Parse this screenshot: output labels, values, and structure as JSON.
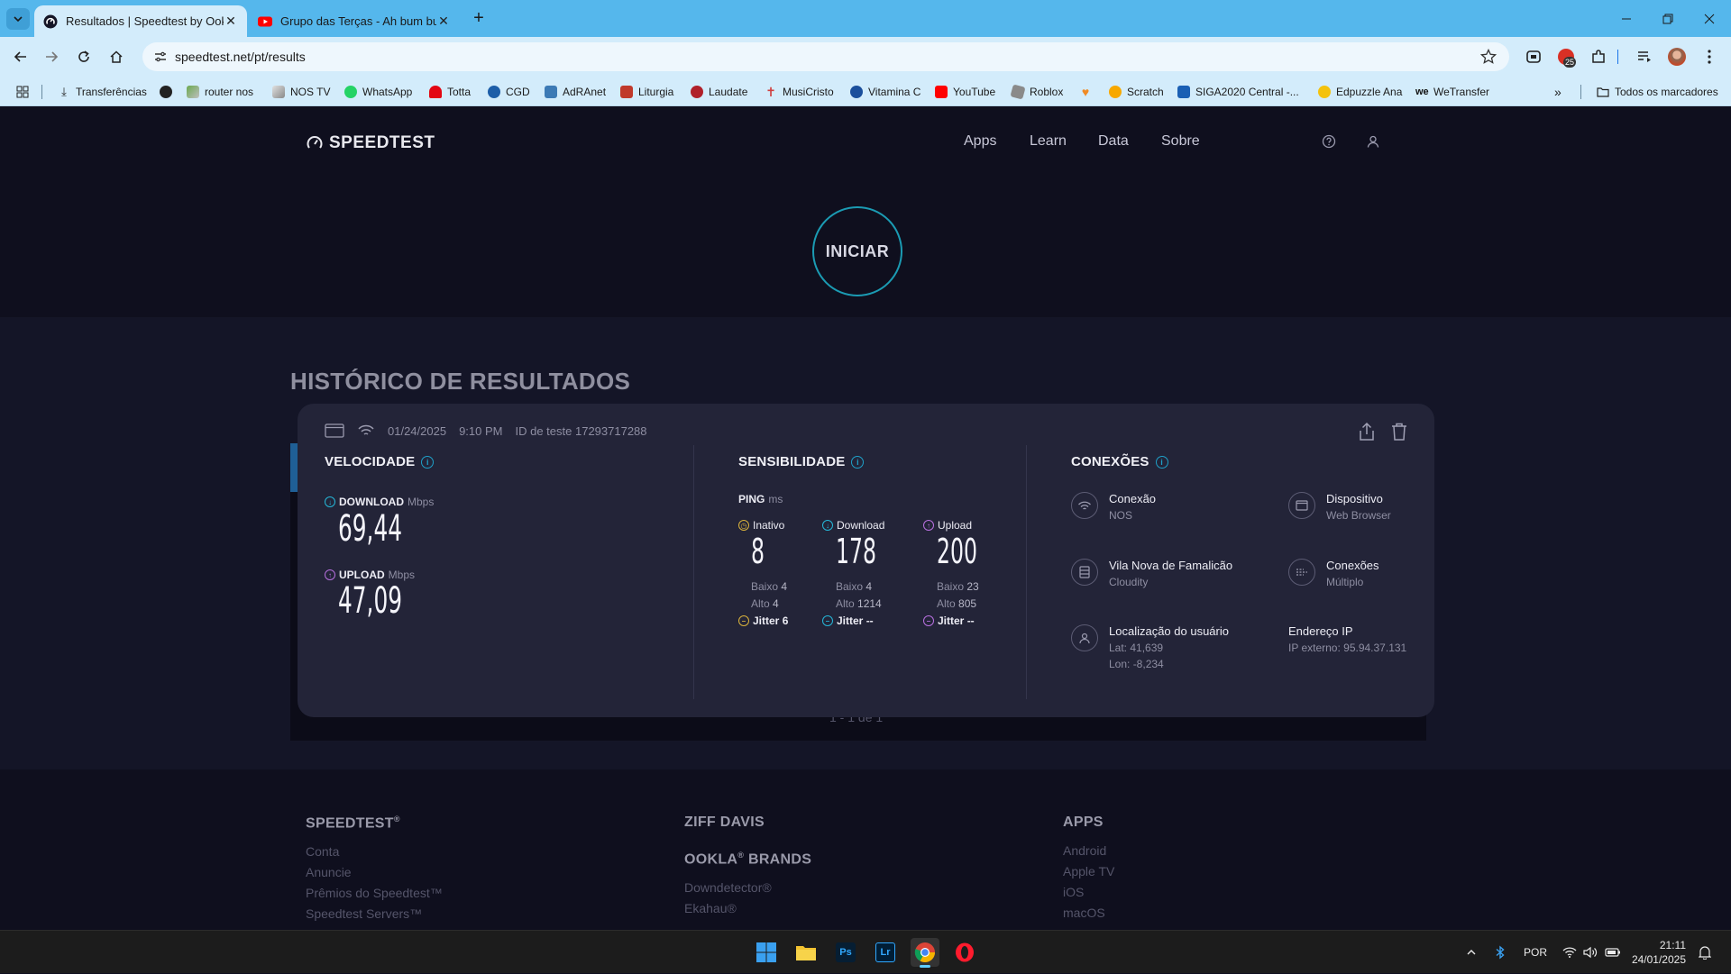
{
  "browser": {
    "tabs": [
      {
        "title": "Resultados | Speedtest by Ookla",
        "active": true
      },
      {
        "title": "Grupo das Terças - Ah bum bué",
        "active": false
      }
    ],
    "url": "speedtest.net/pt/results",
    "extension_badge": "25",
    "bookmarks": [
      {
        "label": "Transferências",
        "icon": "download-icon"
      },
      {
        "label": "",
        "icon": "globe-icon"
      },
      {
        "label": "router nos",
        "icon": "router-icon"
      },
      {
        "label": "NOS TV",
        "icon": "nos-icon"
      },
      {
        "label": "WhatsApp",
        "icon": "whatsapp-icon"
      },
      {
        "label": "Totta",
        "icon": "totta-icon"
      },
      {
        "label": "CGD",
        "icon": "cgd-icon"
      },
      {
        "label": "AdRAnet",
        "icon": "adranet-icon"
      },
      {
        "label": "Liturgia",
        "icon": "liturgia-icon"
      },
      {
        "label": "Laudate",
        "icon": "laudate-icon"
      },
      {
        "label": "MusiCristo",
        "icon": "cross-icon"
      },
      {
        "label": "Vitamina C",
        "icon": "vitamina-icon"
      },
      {
        "label": "YouTube",
        "icon": "youtube-icon"
      },
      {
        "label": "Roblox",
        "icon": "roblox-icon"
      },
      {
        "label": "",
        "icon": "heart-icon"
      },
      {
        "label": "Scratch",
        "icon": "scratch-icon"
      },
      {
        "label": "SIGA2020 Central -...",
        "icon": "siga-icon"
      },
      {
        "label": "Edpuzzle Ana",
        "icon": "edpuzzle-icon"
      },
      {
        "label": "WeTransfer",
        "icon": "wetransfer-icon"
      }
    ],
    "all_bookmarks": "Todos os marcadores"
  },
  "header": {
    "logo": "SPEEDTEST",
    "nav": [
      "Apps",
      "Learn",
      "Data",
      "Sobre"
    ]
  },
  "go_button": "INICIAR",
  "history": {
    "title": "HISTÓRICO DE RESULTADOS",
    "pager": "1 - 1 de 1",
    "card": {
      "date": "01/24/2025",
      "time": "9:10 PM",
      "test_id": "ID de teste 17293717288",
      "velocidade": {
        "title": "VELOCIDADE",
        "download_label": "DOWNLOAD",
        "download_unit": "Mbps",
        "download_value": "69,44",
        "upload_label": "UPLOAD",
        "upload_unit": "Mbps",
        "upload_value": "47,09"
      },
      "sensibilidade": {
        "title": "SENSIBILIDADE",
        "ping_label": "PING",
        "ping_unit": "ms",
        "columns": [
          {
            "label": "Inativo",
            "value": "8",
            "baixo_label": "Baixo",
            "baixo": "4",
            "alto_label": "Alto",
            "alto": "4",
            "jitter_label": "Jitter",
            "jitter": "6",
            "color": "#d9b23c"
          },
          {
            "label": "Download",
            "value": "178",
            "baixo_label": "Baixo",
            "baixo": "4",
            "alto_label": "Alto",
            "alto": "1214",
            "jitter_label": "Jitter",
            "jitter": "--",
            "color": "#25b7d8"
          },
          {
            "label": "Upload",
            "value": "200",
            "baixo_label": "Baixo",
            "baixo": "23",
            "alto_label": "Alto",
            "alto": "805",
            "jitter_label": "Jitter",
            "jitter": "--",
            "color": "#b870e0"
          }
        ]
      },
      "conexoes": {
        "title": "CONEXÕES",
        "items": [
          {
            "title": "Conexão",
            "sub": "NOS",
            "icon": "wifi-icon"
          },
          {
            "title": "Dispositivo",
            "sub": "Web Browser",
            "icon": "browser-icon"
          },
          {
            "title": "Vila Nova de Famalicão",
            "sub": "Cloudity",
            "icon": "server-icon"
          },
          {
            "title": "Conexões",
            "sub": "Múltiplo",
            "icon": "connections-icon"
          },
          {
            "title": "Localização do usuário",
            "sub": "Lat: 41,639",
            "sub2": "Lon: -8,234",
            "icon": "user-location-icon"
          },
          {
            "title": "Endereço IP",
            "sub": "IP externo: 95.94.37.131",
            "icon": ""
          }
        ]
      }
    }
  },
  "footer": {
    "col1": {
      "head": "SPEEDTEST",
      "head_sup": "®",
      "links": [
        "Conta",
        "Anuncie",
        "Prêmios do Speedtest™",
        "Speedtest Servers™"
      ]
    },
    "col2": {
      "head": "ZIFF DAVIS",
      "head2": "OOKLA",
      "head2_sup": "®",
      "head2_rest": " BRANDS",
      "links": [
        "Downdetector®",
        "Ekahau®"
      ]
    },
    "col3": {
      "head": "APPS",
      "links": [
        "Android",
        "Apple TV",
        "iOS",
        "macOS"
      ]
    }
  },
  "taskbar": {
    "lang": "POR",
    "time": "21:11",
    "date": "24/01/2025"
  },
  "colors": {
    "accent": "#1b9bb3",
    "card": "#232438",
    "page": "#0f0f1e"
  }
}
